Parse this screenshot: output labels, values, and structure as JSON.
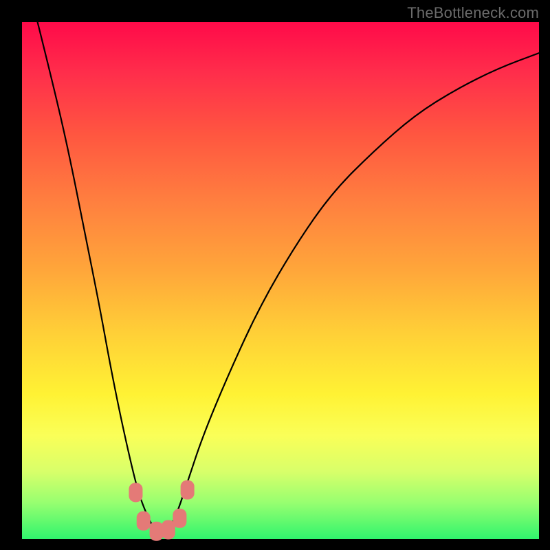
{
  "watermark": {
    "text": "TheBottleneck.com"
  },
  "chart_data": {
    "type": "line",
    "title": "",
    "xlabel": "",
    "ylabel": "",
    "xlim": [
      0,
      100
    ],
    "ylim": [
      0,
      100
    ],
    "grid": false,
    "legend": false,
    "series": [
      {
        "name": "curve",
        "color": "#000000",
        "x": [
          3,
          6,
          9,
          12,
          15,
          17,
          19,
          21,
          22.5,
          24,
          25.5,
          27,
          28.5,
          30,
          32,
          35,
          40,
          46,
          53,
          60,
          68,
          76,
          84,
          92,
          100
        ],
        "values": [
          100,
          88,
          75,
          60,
          45,
          34,
          24,
          15,
          9,
          5,
          2,
          1,
          2,
          5,
          11,
          20,
          32,
          45,
          57,
          67,
          75,
          82,
          87,
          91,
          94
        ]
      }
    ],
    "markers": [
      {
        "x": 22.0,
        "y": 9.0,
        "color": "#e47a77"
      },
      {
        "x": 23.5,
        "y": 3.5,
        "color": "#e47a77"
      },
      {
        "x": 26.0,
        "y": 1.5,
        "color": "#e47a77"
      },
      {
        "x": 28.3,
        "y": 1.8,
        "color": "#e47a77"
      },
      {
        "x": 30.5,
        "y": 4.0,
        "color": "#e47a77"
      },
      {
        "x": 32.0,
        "y": 9.5,
        "color": "#e47a77"
      }
    ]
  }
}
